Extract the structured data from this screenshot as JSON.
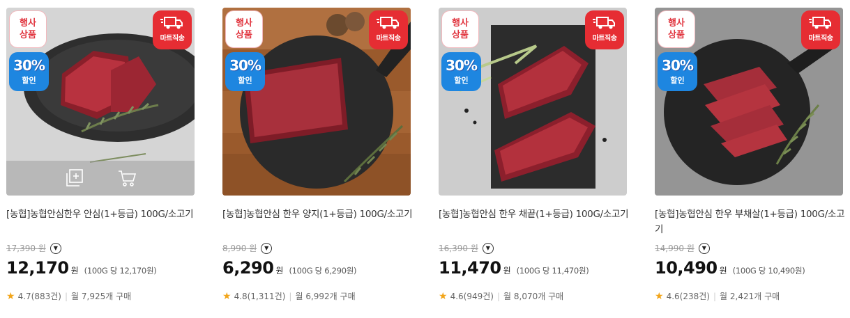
{
  "badges": {
    "event": "행사\n상품",
    "delivery": "마트직송",
    "discount_pct": "30%",
    "discount_label": "할인"
  },
  "colors": {
    "accent_red": "#e62d33",
    "accent_blue": "#1e86e0",
    "star": "#f2a51a"
  },
  "icons": {
    "delivery": "truck-icon",
    "compare": "add-to-list-icon",
    "cart": "cart-icon",
    "star": "star-icon",
    "dropdown": "chevron-down-icon"
  },
  "products": [
    {
      "name": "[농협]농협안심한우 안심(1+등급) 100G/소고기",
      "original_price": "17,390",
      "orig_won": "원",
      "price": "12,170",
      "won": "원",
      "unit_price": "(100G 당 12,170원)",
      "rating": "4.7",
      "reviews": "(883건)",
      "monthly": "월 7,925개 구매"
    },
    {
      "name": "[농협]농협안심 한우 양지(1+등급) 100G/소고기",
      "original_price": "8,990",
      "orig_won": "원",
      "price": "6,290",
      "won": "원",
      "unit_price": "(100G 당 6,290원)",
      "rating": "4.8",
      "reviews": "(1,311건)",
      "monthly": "월 6,992개 구매"
    },
    {
      "name": "[농협]농협안심 한우 채끝(1+등급) 100G/소고기",
      "original_price": "16,390",
      "orig_won": "원",
      "price": "11,470",
      "won": "원",
      "unit_price": "(100G 당 11,470원)",
      "rating": "4.6",
      "reviews": "(949건)",
      "monthly": "월 8,070개 구매"
    },
    {
      "name": "[농협]농협안심 한우 부채살(1+등급) 100G/소고기",
      "original_price": "14,990",
      "orig_won": "원",
      "price": "10,490",
      "won": "원",
      "unit_price": "(100G 당 10,490원)",
      "rating": "4.6",
      "reviews": "(238건)",
      "monthly": "월 2,421개 구매"
    }
  ]
}
